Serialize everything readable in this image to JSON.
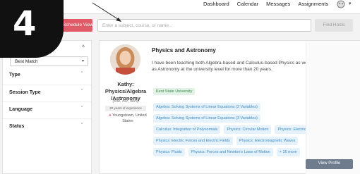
{
  "nav": {
    "links": [
      "Dashboard",
      "Calendar",
      "Messages",
      "Assignments"
    ]
  },
  "badge": {
    "number": "4"
  },
  "search": {
    "schedule_label": "Schedule View",
    "placeholder": "Enter a subject, course, or name...",
    "find_label": "Find Hosts"
  },
  "filters": {
    "sort_value": "Best Match",
    "rows": [
      "Type",
      "Session Type",
      "Language",
      "Status"
    ]
  },
  "tutor": {
    "name": "Kathy: Physics/Algebra /Astronomy",
    "pronouns": "(she, her, hers)",
    "experience": "20 years of experience",
    "location": "Youngstown, United States",
    "title": "Physics and Astronomy",
    "bio": "I have been teaching both Algebra-based and Calculus-based Physics as well as Astronomy at the university level for more than 20 years.",
    "university": "Kent State University",
    "tags": [
      "Algebra: Solving Systems of Linear Equations (2 Variables)",
      "Algebra: Solving Systems of Linear Equations (3 Variables)",
      "Calculus: Integration of Polynomials",
      "Physics: Circular Motion",
      "Physics: Electric Circuits",
      "Physics: Electric Forces and Electric Fields",
      "Physics: Electromagnetic Waves",
      "Physics: Fluids",
      "Physics: Forces and Newton's Laws of Motion",
      "+ 16 more"
    ],
    "view_profile": "View Profile"
  },
  "colors": {
    "accent": "#e05a68",
    "tag_text": "#3d8bc2",
    "university_text": "#3a8a4a",
    "view_button": "#6e7c8e"
  }
}
